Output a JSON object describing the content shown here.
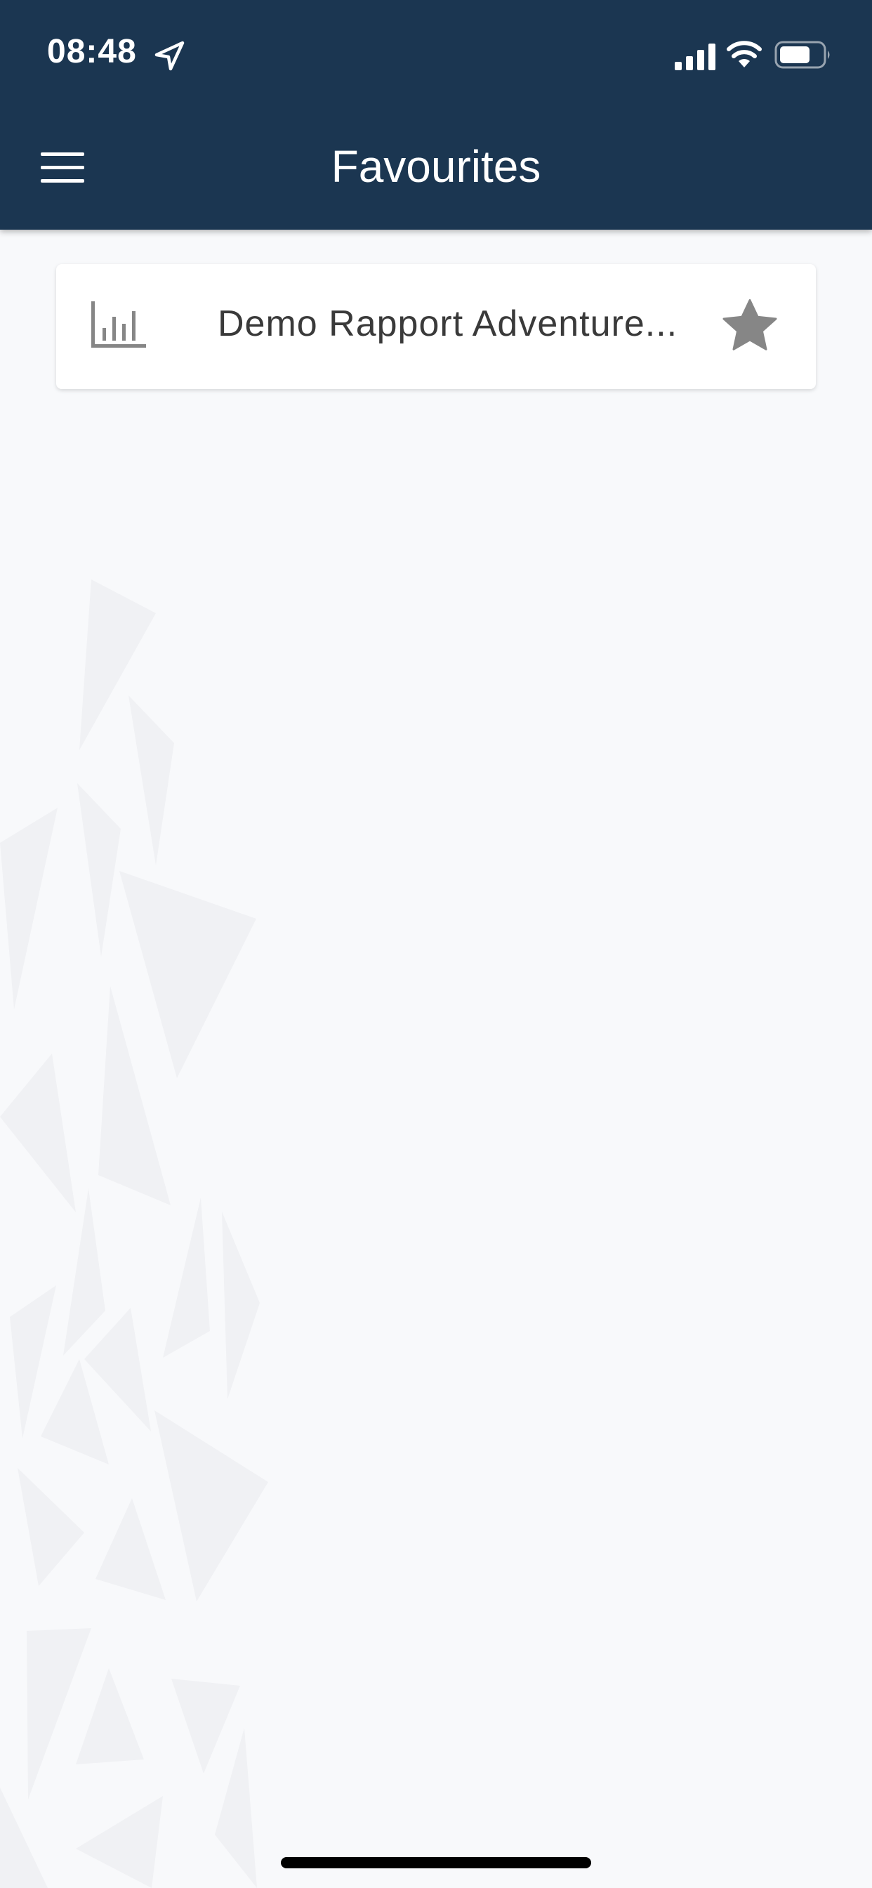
{
  "status_bar": {
    "time": "08:48",
    "icons": [
      "location-arrow-icon",
      "cellular-signal-icon",
      "wifi-icon",
      "battery-icon"
    ]
  },
  "header": {
    "title": "Favourites",
    "menu_icon": "hamburger-menu-icon",
    "background_color": "#1b3651"
  },
  "favourites": {
    "items": [
      {
        "label": "Demo Rapport Adventure...",
        "icon": "bar-chart-icon",
        "starred": true
      }
    ]
  },
  "colors": {
    "background": "#f8f9fb",
    "icon_gray": "#868686",
    "card": "#ffffff"
  }
}
